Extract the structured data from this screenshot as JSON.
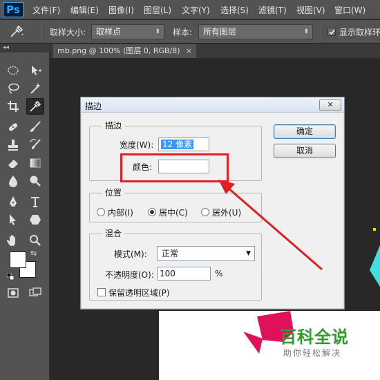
{
  "app": {
    "logo": "Ps"
  },
  "menu": [
    "文件(F)",
    "编辑(E)",
    "图像(I)",
    "图层(L)",
    "文字(Y)",
    "选择(S)",
    "滤镜(T)",
    "视图(V)",
    "窗口(W)"
  ],
  "options": {
    "sample_size_label": "取样大小:",
    "sample_size_value": "取样点",
    "sample_label": "样本:",
    "sample_value": "所有图层",
    "show_ring_label": "显示取样环"
  },
  "tools_header": "◂◂",
  "document_tab": {
    "title": "mb.png @ 100% (图层 0, RGB/8)",
    "close": "×"
  },
  "dialog": {
    "title": "描边",
    "close": "✕",
    "stroke_group": {
      "title": "描边",
      "width_label": "宽度(W):",
      "width_value": "12 像素",
      "color_label": "颜色:"
    },
    "position_group": {
      "title": "位置",
      "inside": "内部(I)",
      "center": "居中(C)",
      "outside": "居外(U)",
      "selected": "center"
    },
    "blend_group": {
      "title": "混合",
      "mode_label": "模式(M):",
      "mode_value": "正常",
      "opacity_label": "不透明度(O):",
      "opacity_value": "100",
      "opacity_unit": "%",
      "preserve_label": "保留透明区域(P)"
    },
    "ok": "确定",
    "cancel": "取消"
  },
  "watermark": {
    "main": "百科全说",
    "sub": "助你轻松解决"
  },
  "colors": {
    "annotation": "#e02020",
    "accent": "#31a8ff"
  }
}
